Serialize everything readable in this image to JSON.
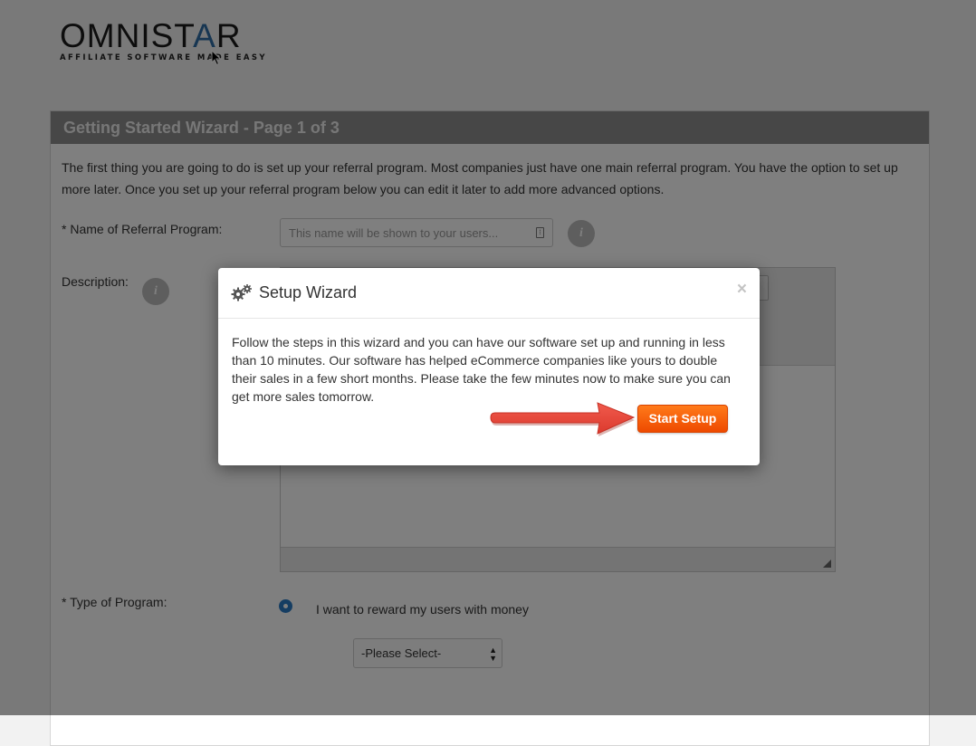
{
  "logo": {
    "main_left": "OMNIST",
    "main_star": "A",
    "main_right": "R",
    "tagline": "AFFILIATE SOFTWARE MADE EASY"
  },
  "wizard": {
    "header": "Getting Started Wizard - Page 1 of 3",
    "intro": "The first thing you are going to do is set up your referral program. Most companies just have one main referral program. You have the option to set up more later. Once you set up your referral program below you can edit it later to add more advanced options.",
    "name_label": "* Name of Referral Program:",
    "name_placeholder": "This name will be shown to your users...",
    "description_label": "Description:",
    "type_label": "* Type of Program:",
    "type_option_money": "I want to reward my users with money",
    "select_value": "-Please Select-"
  },
  "icons": {
    "info": "i",
    "info_icon_name": "info-icon",
    "gears_icon_name": "gears-icon",
    "close_glyph": "×"
  },
  "modal": {
    "title": "Setup Wizard",
    "body": "Follow the steps in this wizard and you can have our software set up and running in less than 10 minutes. Our software has helped eCommerce companies like yours to double their sales in a few short months. Please take the few minutes now to make sure you can get more sales tomorrow.",
    "start_button": "Start Setup"
  },
  "colors": {
    "accent_orange": "#f35a00",
    "arrow_red": "#e8473b",
    "radio_blue": "#2b7bc4",
    "header_gray": "#8f8f8f"
  }
}
